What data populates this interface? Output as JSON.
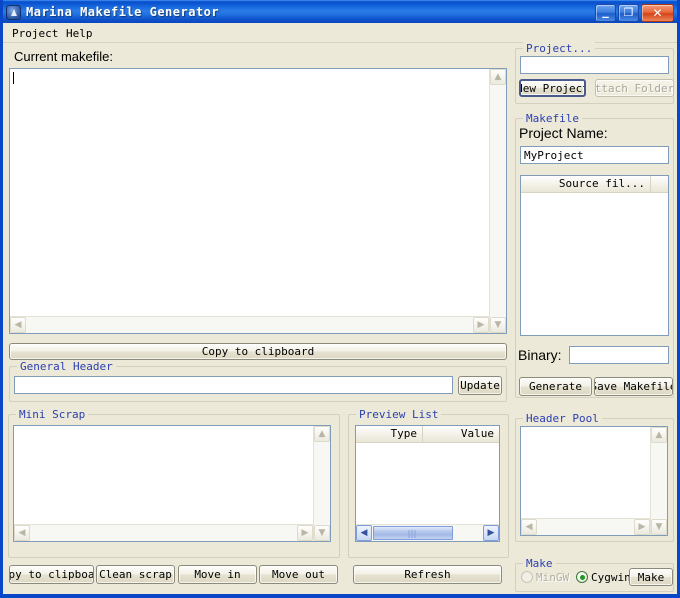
{
  "window": {
    "title": "Marina Makefile Generator",
    "icon": "app-icon",
    "controls": {
      "minimize": "_",
      "maximize": "❐",
      "close": "✕"
    }
  },
  "menu": {
    "items": [
      {
        "label": "Project"
      },
      {
        "label": "Help"
      }
    ]
  },
  "main": {
    "current_makefile_label": "Current makefile:",
    "makefile_text": "",
    "copy_to_clipboard_button": "Copy to clipboard",
    "general_header": {
      "group_title": "General Header",
      "value": "",
      "update_button": "Update"
    }
  },
  "mini_scrap": {
    "group_title": "Mini Scrap",
    "content": "",
    "buttons": [
      {
        "label": "opy to clipboar",
        "full_label": "Copy to clipboard"
      },
      {
        "label": "Clean scrap"
      },
      {
        "label": "Move in"
      },
      {
        "label": "Move out"
      }
    ]
  },
  "preview_list": {
    "group_title": "Preview List",
    "columns": [
      "Type",
      "Value"
    ],
    "rows": [],
    "refresh_button": "Refresh"
  },
  "project": {
    "group_title": "Project...",
    "path_value": "",
    "new_project_button": "New Project",
    "attach_folder_button": "ttach Folder",
    "attach_folder_full": "Attach Folder"
  },
  "makefile": {
    "group_title": "Makefile",
    "project_name_label": "Project Name:",
    "project_name_value": "MyProject",
    "source_files": {
      "columns": [
        "Source fil..."
      ],
      "rows": []
    },
    "binary_label": "Binary:",
    "binary_value": "",
    "generate_button": "Generate",
    "save_makefile_button": "Save Makefile"
  },
  "header_pool": {
    "group_title": "Header Pool",
    "items": []
  },
  "make": {
    "group_title": "Make",
    "options": [
      {
        "label": "MinGW",
        "selected": false,
        "enabled": false
      },
      {
        "label": "Cygwin",
        "selected": true,
        "enabled": true
      }
    ],
    "make_button": "Make"
  },
  "colors": {
    "titlebar": "#1363db",
    "window_bg": "#ece9d8",
    "group_label": "#2b3fb0",
    "field_bg": "#ffffff",
    "field_border": "#7f9db9",
    "radio_on": "#1f9c1f"
  }
}
